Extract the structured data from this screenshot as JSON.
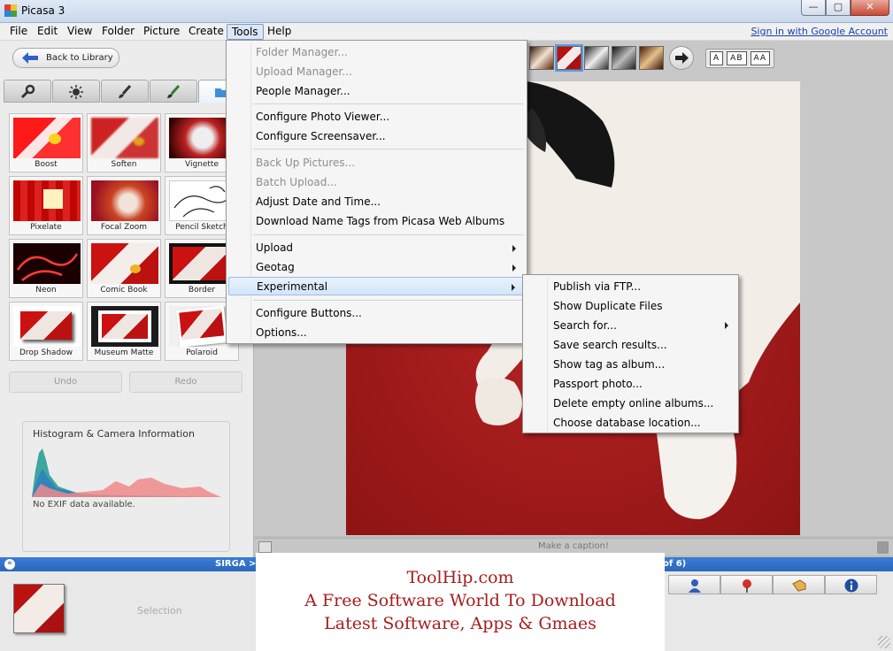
{
  "window": {
    "title": "Picasa 3",
    "controls": {
      "minimize": "—",
      "maximize": "▢",
      "close": "✕"
    }
  },
  "menubar": {
    "items": [
      "File",
      "Edit",
      "View",
      "Folder",
      "Picture",
      "Create",
      "Tools",
      "Help"
    ],
    "active": "Tools",
    "signin": "Sign in with Google Account"
  },
  "leftpanel": {
    "back_label": "Back to Library",
    "tabs": [
      "wrench-icon",
      "sun-icon",
      "brush-icon",
      "brush-palette-icon",
      "folder-icon"
    ],
    "effects": [
      "Boost",
      "Soften",
      "Vignette",
      "Pixelate",
      "Focal Zoom",
      "Pencil Sketch",
      "Neon",
      "Comic Book",
      "Border",
      "Drop Shadow",
      "Museum Matte",
      "Polaroid"
    ],
    "undo": "Undo",
    "redo": "Redo",
    "histogram": {
      "title": "Histogram & Camera Information",
      "exif": "No EXIF data available."
    }
  },
  "toolbar": {
    "text_styles": [
      "A",
      "AB",
      "AA"
    ]
  },
  "caption": {
    "placeholder": "Make a caption!"
  },
  "statusbar": {
    "collapse": "«",
    "folder": "SIRGA > 56",
    "count": "of 6)"
  },
  "tray": {
    "selection": "Selection"
  },
  "tools_menu": {
    "items": [
      {
        "label": "Folder Manager...",
        "disabled": true
      },
      {
        "label": "Upload Manager...",
        "disabled": true
      },
      {
        "label": "People Manager...",
        "disabled": false
      },
      {
        "label": "Configure Photo Viewer...",
        "disabled": false
      },
      {
        "label": "Configure Screensaver...",
        "disabled": false
      },
      {
        "label": "Back Up Pictures...",
        "disabled": true
      },
      {
        "label": "Batch Upload...",
        "disabled": true
      },
      {
        "label": "Adjust Date and Time...",
        "disabled": false
      },
      {
        "label": "Download Name Tags from Picasa Web Albums",
        "disabled": false
      },
      {
        "label": "Upload",
        "disabled": false,
        "submenu": true
      },
      {
        "label": "Geotag",
        "disabled": false,
        "submenu": true
      },
      {
        "label": "Experimental",
        "disabled": false,
        "submenu": true,
        "highlighted": true
      },
      {
        "label": "Configure Buttons...",
        "disabled": false
      },
      {
        "label": "Options...",
        "disabled": false
      }
    ]
  },
  "experimental_menu": {
    "items": [
      {
        "label": "Publish via FTP..."
      },
      {
        "label": "Show Duplicate Files"
      },
      {
        "label": "Search for...",
        "submenu": true
      },
      {
        "label": "Save search results..."
      },
      {
        "label": "Show tag as album..."
      },
      {
        "label": "Passport photo..."
      },
      {
        "label": "Delete empty online albums..."
      },
      {
        "label": "Choose database location..."
      }
    ]
  },
  "watermark": {
    "line1": "ToolHip.com",
    "line2": "A Free Software World To Download",
    "line3": "Latest Software, Apps & Gmaes"
  },
  "colors": {
    "status_blue": "#2b67bd",
    "carpet_red": "#a81d1d",
    "watermark_red": "#a61c1c"
  }
}
